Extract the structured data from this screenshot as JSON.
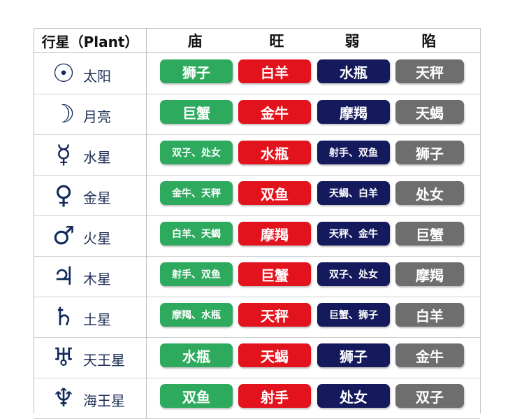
{
  "header": {
    "planet": "行星（Plant）",
    "miao": "庙",
    "wang": "旺",
    "ruo": "弱",
    "xian": "陷"
  },
  "colors": {
    "miao": "#2eaa5e",
    "wang": "#e3131e",
    "ruo": "#141a5c",
    "xian": "#6e6e6e"
  },
  "rows": [
    {
      "symbol": "☉",
      "name": "太阳",
      "miao": "狮子",
      "wang": "白羊",
      "ruo": "水瓶",
      "xian": "天秤"
    },
    {
      "symbol": "☽",
      "name": "月亮",
      "miao": "巨蟹",
      "wang": "金牛",
      "ruo": "摩羯",
      "xian": "天蝎"
    },
    {
      "symbol": "☿",
      "name": "水星",
      "miao": "双子、处女",
      "wang": "水瓶",
      "ruo": "射手、双鱼",
      "xian": "狮子"
    },
    {
      "symbol": "♀",
      "name": "金星",
      "miao": "金牛、天秤",
      "wang": "双鱼",
      "ruo": "天蝎、白羊",
      "xian": "处女"
    },
    {
      "symbol": "♂",
      "name": "火星",
      "miao": "白羊、天蝎",
      "wang": "摩羯",
      "ruo": "天秤、金牛",
      "xian": "巨蟹"
    },
    {
      "symbol": "♃",
      "name": "木星",
      "miao": "射手、双鱼",
      "wang": "巨蟹",
      "ruo": "双子、处女",
      "xian": "摩羯"
    },
    {
      "symbol": "♄",
      "name": "土星",
      "miao": "摩羯、水瓶",
      "wang": "天秤",
      "ruo": "巨蟹、狮子",
      "xian": "白羊"
    },
    {
      "symbol": "♅",
      "name": "天王星",
      "miao": "水瓶",
      "wang": "天蝎",
      "ruo": "狮子",
      "xian": "金牛"
    },
    {
      "symbol": "♆",
      "name": "海王星",
      "miao": "双鱼",
      "wang": "射手",
      "ruo": "处女",
      "xian": "双子"
    }
  ]
}
